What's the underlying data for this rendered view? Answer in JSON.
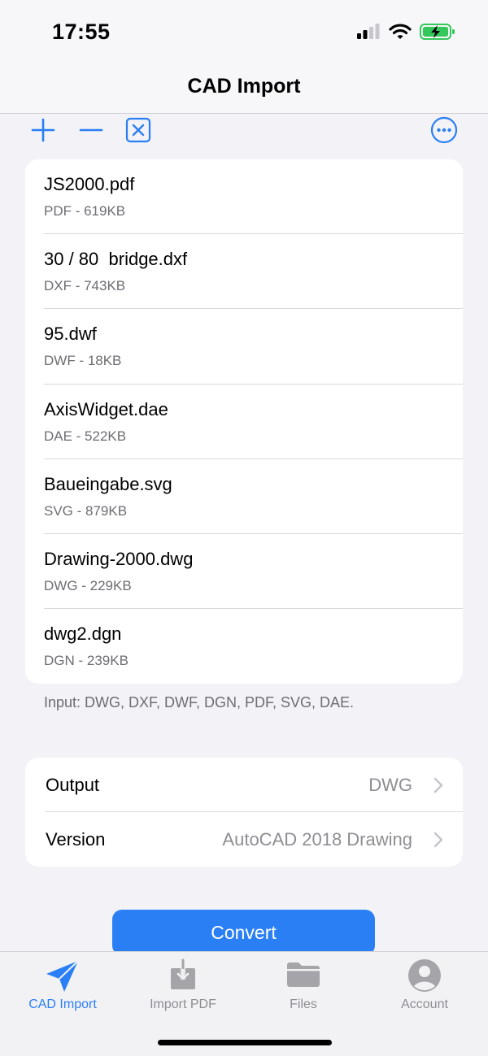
{
  "status": {
    "time": "17:55"
  },
  "nav": {
    "title": "CAD Import"
  },
  "toolbar": {
    "add_icon": "plus-icon",
    "remove_icon": "minus-icon",
    "clear_icon": "x-square-icon",
    "more_icon": "ellipsis-circle-icon"
  },
  "files": [
    {
      "name": "JS2000.pdf",
      "meta": "PDF - 619KB"
    },
    {
      "name": "30 / 80  bridge.dxf",
      "meta": "DXF - 743KB"
    },
    {
      "name": "95.dwf",
      "meta": "DWF - 18KB"
    },
    {
      "name": "AxisWidget.dae",
      "meta": "DAE - 522KB"
    },
    {
      "name": "Baueingabe.svg",
      "meta": "SVG - 879KB"
    },
    {
      "name": "Drawing-2000.dwg",
      "meta": "DWG - 229KB"
    },
    {
      "name": "dwg2.dgn",
      "meta": "DGN - 239KB"
    }
  ],
  "input_note": "Input: DWG, DXF, DWF, DGN, PDF, SVG, DAE.",
  "settings": {
    "output": {
      "label": "Output",
      "value": "DWG"
    },
    "version": {
      "label": "Version",
      "value": "AutoCAD 2018 Drawing"
    }
  },
  "convert_label": "Convert",
  "tabs": [
    {
      "label": "CAD Import",
      "icon": "paper-plane-icon",
      "active": true
    },
    {
      "label": "Import PDF",
      "icon": "download-tray-icon",
      "active": false
    },
    {
      "label": "Files",
      "icon": "folder-icon",
      "active": false
    },
    {
      "label": "Account",
      "icon": "person-circle-icon",
      "active": false
    }
  ],
  "colors": {
    "accent": "#2a7ff5",
    "secondary_text": "#6d6d72"
  }
}
